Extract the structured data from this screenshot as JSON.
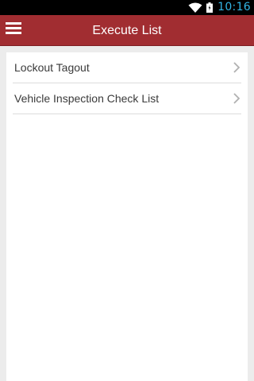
{
  "status_bar": {
    "time": "10:16",
    "icons": [
      "wifi-icon",
      "battery-icon"
    ],
    "clock_color": "#33b5e5"
  },
  "action_bar": {
    "title": "Execute List",
    "menu_icon": "hamburger-menu-icon",
    "background_color": "#a12d31"
  },
  "list": {
    "items": [
      {
        "label": "Lockout Tagout",
        "icon": "chevron-right-icon"
      },
      {
        "label": "Vehicle Inspection Check List",
        "icon": "chevron-right-icon"
      }
    ]
  }
}
